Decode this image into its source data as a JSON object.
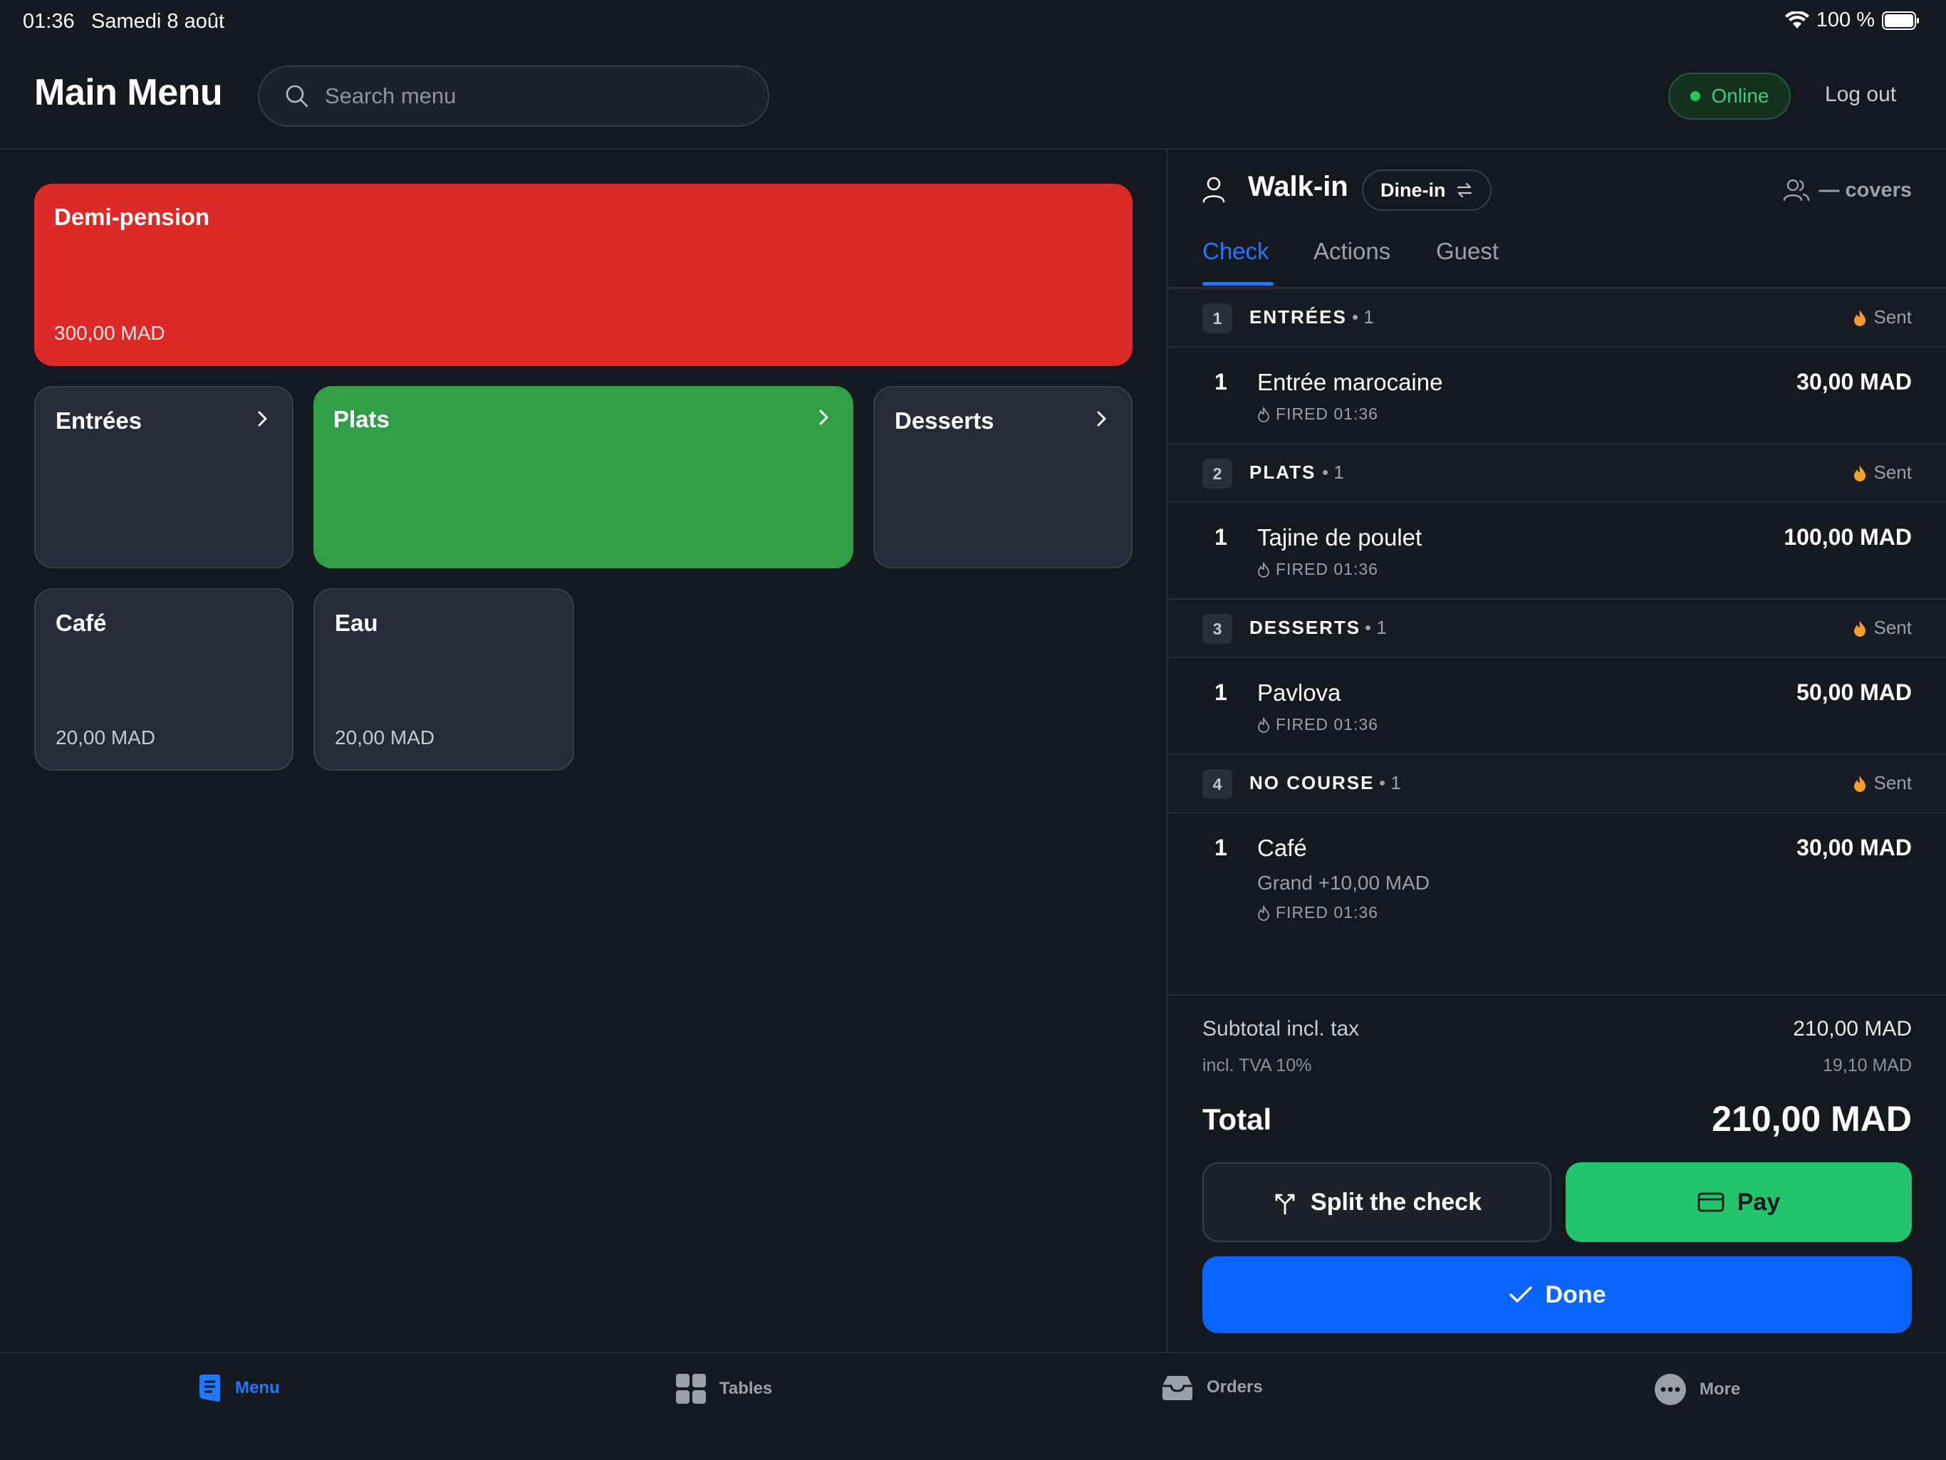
{
  "status_bar": {
    "time": "01:36",
    "date": "Samedi 8 août",
    "battery": "100 %"
  },
  "header": {
    "title": "Main Menu",
    "search_placeholder": "Search menu",
    "status": "Online",
    "logout": "Log out"
  },
  "menu": {
    "featured": {
      "name": "Demi-pension",
      "price": "300,00 MAD"
    },
    "categories": [
      {
        "name": "Entrées"
      },
      {
        "name": "Plats"
      },
      {
        "name": "Desserts"
      }
    ],
    "items": [
      {
        "name": "Café",
        "price": "20,00 MAD"
      },
      {
        "name": "Eau",
        "price": "20,00 MAD"
      }
    ]
  },
  "order": {
    "guest": "Walk-in",
    "mode": "Dine-in",
    "covers": "— covers",
    "tabs": [
      "Check",
      "Actions",
      "Guest"
    ],
    "courses": [
      {
        "num": "1",
        "name": "ENTRÉES",
        "count": "• 1",
        "status": "Sent",
        "items": [
          {
            "qty": "1",
            "name": "Entrée marocaine",
            "price": "30,00 MAD",
            "fired": "FIRED 01:36"
          }
        ]
      },
      {
        "num": "2",
        "name": "PLATS",
        "count": "• 1",
        "status": "Sent",
        "items": [
          {
            "qty": "1",
            "name": "Tajine de poulet",
            "price": "100,00 MAD",
            "fired": "FIRED 01:36"
          }
        ]
      },
      {
        "num": "3",
        "name": "DESSERTS",
        "count": "• 1",
        "status": "Sent",
        "items": [
          {
            "qty": "1",
            "name": "Pavlova",
            "price": "50,00 MAD",
            "fired": "FIRED 01:36"
          }
        ]
      },
      {
        "num": "4",
        "name": "NO COURSE",
        "count": "• 1",
        "status": "Sent",
        "items": [
          {
            "qty": "1",
            "name": "Café",
            "price": "30,00 MAD",
            "modifier": "Grand +10,00 MAD",
            "fired": "FIRED 01:36"
          }
        ]
      }
    ],
    "subtotal_label": "Subtotal incl. tax",
    "subtotal_value": "210,00 MAD",
    "tax_label": "incl. TVA 10%",
    "tax_value": "19,10 MAD",
    "total_label": "Total",
    "total_value": "210,00 MAD",
    "split_label": "Split the check",
    "pay_label": "Pay",
    "done_label": "Done"
  },
  "nav": {
    "items": [
      "Menu",
      "Tables",
      "Orders",
      "More"
    ],
    "active": "Menu"
  },
  "colors": {
    "accent": "#1f78ff",
    "pay": "#22c46c",
    "featured": "#dc2a28",
    "plats": "#2f9e47",
    "online": "#22c55e",
    "flame": "#f59e2b"
  },
  "icons": [
    "search-icon",
    "user-icon",
    "swap-icon",
    "users-icon",
    "flame-icon",
    "split-icon",
    "card-icon",
    "check-icon",
    "menu-icon",
    "tables-icon",
    "orders-icon",
    "more-icon"
  ]
}
